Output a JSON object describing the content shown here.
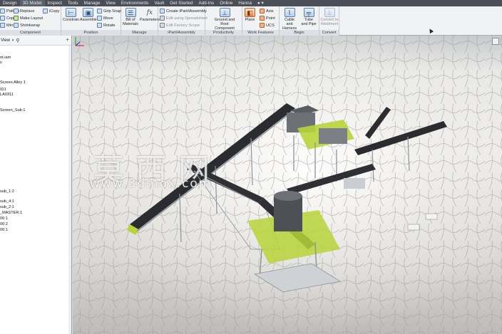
{
  "menu": {
    "tabs": [
      "Design",
      "3D Model",
      "Inspect",
      "Tools",
      "Manage",
      "View",
      "Environments",
      "Vault",
      "Get Started",
      "Add-Ins",
      "Online",
      "Hanna"
    ],
    "extra_icon": "dropdown-toggle-icon"
  },
  "ribbon": {
    "component": {
      "title": "Component",
      "items": [
        "Pattern",
        "Copy",
        "Mirror"
      ],
      "items2": [
        "Replace",
        "Make Layout",
        "Shrinkwrap"
      ],
      "items3": [
        "iCopy"
      ]
    },
    "position": {
      "title": "Position",
      "constrain": "Constrain",
      "assemble": "Assemble",
      "grip_snap": "Grip Snap",
      "move": "Move",
      "rotate": "Rotate"
    },
    "manage": {
      "title": "Manage",
      "bom": "Bill of Materials",
      "parameters": "Parameters",
      "fx_icon": "fx"
    },
    "ipart": {
      "title": "iPart/iAssembly",
      "create": "Create iPart/iAssembly",
      "edit_member": "Edit using Spreadsheet",
      "edit_factory": "Edit Factory Scope"
    },
    "productivity": {
      "title": "Productivity",
      "ground_root": "Ground and Root Component"
    },
    "work_features": {
      "title": "Work Features",
      "plane": "Plane",
      "axis": "Axis",
      "point": "Point",
      "ucs": "UCS"
    },
    "begin": {
      "title": "Begin",
      "cable": "Cable and Harness",
      "tube": "Tube and Pipe"
    },
    "convert": {
      "title": "Convert",
      "convert_weldment": "Convert to Weldment"
    }
  },
  "browser": {
    "view_label": "View",
    "rows": [
      "nt.iam",
      "s",
      "Screen Alley 1",
      "",
      "ID1",
      "LA0311",
      "",
      "",
      "",
      "",
      "Screen_Sub:1",
      "",
      "",
      "",
      "",
      "",
      "",
      "",
      "",
      "",
      "",
      "",
      "",
      "",
      "",
      "",
      "",
      "sub_1:2",
      "sub_4:1",
      "sub_2:1",
      "_MASTER:1",
      "00:1",
      "00:2",
      "00:1"
    ]
  },
  "viewport": {
    "watermark_cn": "莫西网",
    "watermark_url": "www.3dmox.com",
    "steel_color": "#8e949a",
    "accent_color": "#b8d43a"
  }
}
